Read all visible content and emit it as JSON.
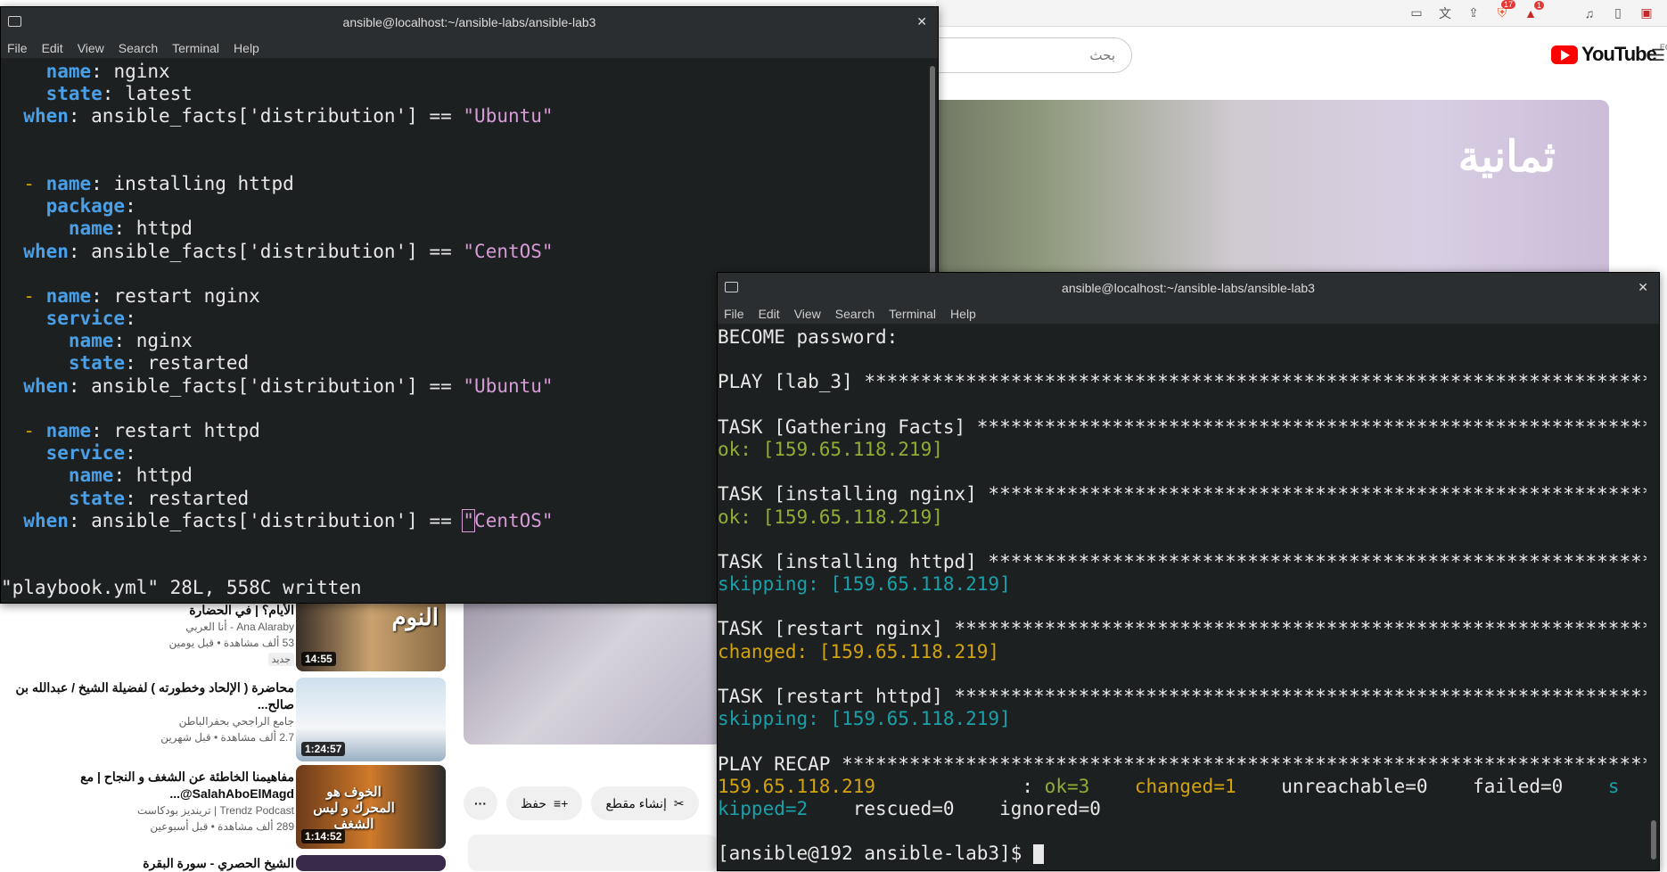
{
  "browser": {
    "toolbar_icons": [
      "screen-icon",
      "translate-icon",
      "share-icon",
      "brave-shield-icon",
      "brave-rewards-icon",
      "music-icon",
      "sidebar-icon",
      "wallet-icon"
    ],
    "shield_badge": "17",
    "rewards_badge": "1",
    "search_placeholder": "بحث",
    "youtube_label": "YouTube",
    "region": "EG",
    "video_title_overlay": "ثمانية",
    "actions": {
      "save": "حفظ",
      "clip": "إنشاء مقطع",
      "more": "···"
    },
    "recommendations": [
      {
        "title": "الأيام؟ | في الحضارة",
        "channel": "Ana Alaraby - أنا العربي",
        "meta": "53 ألف مشاهدة • قبل يومين",
        "badge": "جديد",
        "duration": "14:55",
        "thumb_text": "النوم"
      },
      {
        "title": "محاضرة ( الإلحاد وخطورته ) لفضيلة الشيخ / عبدالله بن صالح...",
        "channel": "جامع الراجحي بحفرالباطن",
        "meta": "2.7 ألف مشاهدة • قبل شهرين",
        "badge": "",
        "duration": "1:24:57",
        "thumb_text": ""
      },
      {
        "title": "مفاهيمنا الخاطئة عن الشغف و النجاح | مع SalahAboElMagd@...",
        "channel": "Trendz Podcast | ترينديز بودكاست",
        "meta": "289 ألف مشاهدة • قبل أسبوعين",
        "badge": "",
        "duration": "1:14:52",
        "thumb_text": "الخوف هو المحرك و ليس الشغف"
      },
      {
        "title": "الشيخ الحصري - سورة البقرة",
        "channel": "",
        "meta": "",
        "badge": "",
        "duration": "",
        "thumb_text": ""
      }
    ]
  },
  "terminal_editor": {
    "title": "ansible@localhost:~/ansible-labs/ansible-lab3",
    "menu": [
      "File",
      "Edit",
      "View",
      "Search",
      "Terminal",
      "Help"
    ],
    "status_line": "\"playbook.yml\" 28L, 558C written"
  },
  "terminal_run": {
    "title": "ansible@localhost:~/ansible-labs/ansible-lab3",
    "menu": [
      "File",
      "Edit",
      "View",
      "Search",
      "Terminal",
      "Help"
    ],
    "prompt": "[ansible@192 ansible-lab3]$ "
  },
  "colors": {
    "terminal_bg": "#1d2021",
    "yaml_key": "#4aa0e8",
    "yaml_string": "#d79bd7",
    "ok": "#8fae33",
    "skipping": "#1aa0a8",
    "changed": "#d3a30d"
  }
}
